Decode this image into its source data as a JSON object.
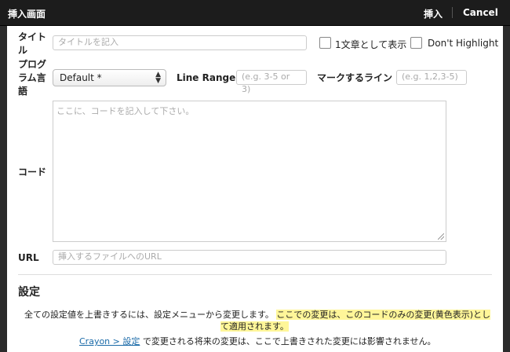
{
  "header": {
    "title": "挿入画面",
    "insert_label": "挿入",
    "cancel_label": "Cancel"
  },
  "form": {
    "title_label": "タイトル",
    "title_placeholder": "タイトルを記入",
    "inline_label": "1文章として表示",
    "no_highlight_label": "Don't Highlight",
    "language_label": "プログラム言語",
    "language_value": "Default *",
    "line_range_label": "Line Range",
    "line_range_placeholder": "(e.g. 3-5 or 3)",
    "mark_lines_label": "マークするライン",
    "mark_lines_placeholder": "(e.g. 1,2,3-5)",
    "code_label": "コード",
    "code_placeholder": "ここに、コードを記入して下さい。",
    "url_label": "URL",
    "url_placeholder": "挿入するファイルへのURL"
  },
  "settings": {
    "heading": "設定",
    "text_plain": "全ての設定値を上書きするには、設定メニューから変更します。",
    "text_highlight_1": "ここでの変更は、このコードのみの変更(黄色表示)とし",
    "text_highlight_2": "て適用されます。",
    "link_text": "Crayon > 設定",
    "text_after_link": " で変更される将来の変更は、ここで上書きされた変更には影響されません。"
  },
  "colors": {
    "highlight": "#fff699",
    "link": "#1a6aa8",
    "titlebar": "#1c1c1c"
  }
}
